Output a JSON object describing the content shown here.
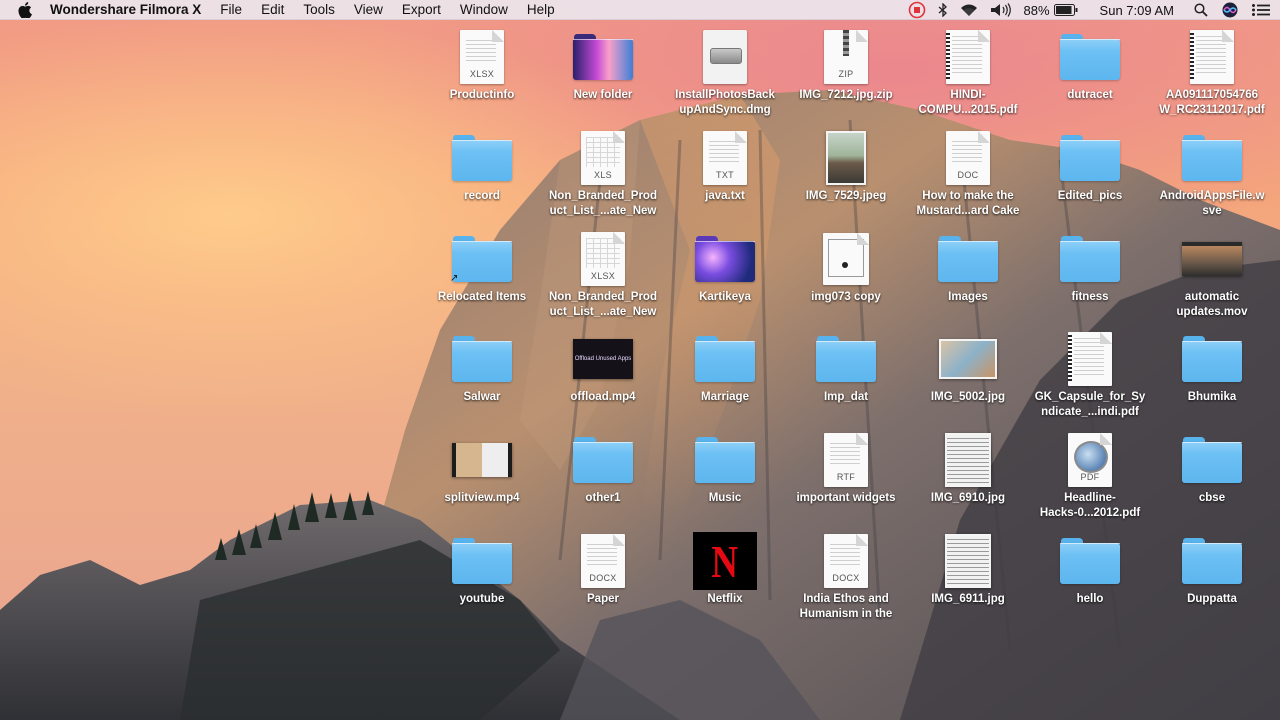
{
  "menubar": {
    "app_name": "Wondershare Filmora X",
    "menus": [
      "File",
      "Edit",
      "Tools",
      "View",
      "Export",
      "Window",
      "Help"
    ],
    "status": {
      "record_icon": "record-stop-icon",
      "bluetooth_icon": "bluetooth-icon",
      "wifi_icon": "wifi-icon",
      "volume_icon": "volume-icon",
      "battery_percent": "88%",
      "clock": "Sun 7:09 AM",
      "search_icon": "spotlight-icon",
      "siri_icon": "siri-icon",
      "notifications_icon": "notification-center-icon"
    }
  },
  "desktop": {
    "items": [
      {
        "label": "Productinfo",
        "kind": "doc",
        "ext": "XLSX"
      },
      {
        "label": "New folder",
        "kind": "folder-custom"
      },
      {
        "label": "InstallPhotosBack\nupAndSync.dmg",
        "kind": "dmg"
      },
      {
        "label": "IMG_7212.jpg.zip",
        "kind": "zip",
        "ext": "ZIP"
      },
      {
        "label": "HINDI-\nCOMPU...2015.pdf",
        "kind": "doc-spiral"
      },
      {
        "label": "dutracet",
        "kind": "folder"
      },
      {
        "label": "AA091117054766\nW_RC23112017.pdf",
        "kind": "doc-spiral"
      },
      {
        "label": "record",
        "kind": "folder"
      },
      {
        "label": "Non_Branded_Prod\nuct_List_...ate_New",
        "kind": "doc-grid",
        "ext": "XLS"
      },
      {
        "label": "java.txt",
        "kind": "doc",
        "ext": "TXT"
      },
      {
        "label": "IMG_7529.jpeg",
        "kind": "photo-person"
      },
      {
        "label": "How to make the\nMustard...ard Cake",
        "kind": "doc",
        "ext": "DOC"
      },
      {
        "label": "Edited_pics",
        "kind": "folder"
      },
      {
        "label": "AndroidAppsFile.w\nsve",
        "kind": "folder"
      },
      {
        "label": "Relocated Items",
        "kind": "folder-alias"
      },
      {
        "label": "Non_Branded_Prod\nuct_List_...ate_New",
        "kind": "doc-grid",
        "ext": "XLSX"
      },
      {
        "label": "Kartikeya",
        "kind": "folder-space"
      },
      {
        "label": "img073 copy",
        "kind": "certificate"
      },
      {
        "label": "Images",
        "kind": "folder"
      },
      {
        "label": "fitness",
        "kind": "folder"
      },
      {
        "label": "automatic\nupdates.mov",
        "kind": "video-desktop"
      },
      {
        "label": "Salwar",
        "kind": "folder"
      },
      {
        "label": "offload.mp4",
        "kind": "video-offload",
        "overlay": "Offload Unused Apps"
      },
      {
        "label": "Marriage",
        "kind": "folder"
      },
      {
        "label": "Imp_dat",
        "kind": "folder"
      },
      {
        "label": "IMG_5002.jpg",
        "kind": "photo-card"
      },
      {
        "label": "GK_Capsule_for_Sy\nndicate_...indi.pdf",
        "kind": "doc-spiral"
      },
      {
        "label": "Bhumika",
        "kind": "folder"
      },
      {
        "label": "splitview.mp4",
        "kind": "video-split"
      },
      {
        "label": "other1",
        "kind": "folder"
      },
      {
        "label": "Music",
        "kind": "folder"
      },
      {
        "label": "important widgets",
        "kind": "doc",
        "ext": "RTF"
      },
      {
        "label": "IMG_6910.jpg",
        "kind": "photo-form"
      },
      {
        "label": "Headline-\nHacks-0...2012.pdf",
        "kind": "doc-pdf",
        "ext": "PDF"
      },
      {
        "label": "cbse",
        "kind": "folder"
      },
      {
        "label": "youtube",
        "kind": "folder"
      },
      {
        "label": "Paper",
        "kind": "doc",
        "ext": "DOCX"
      },
      {
        "label": "Netflix",
        "kind": "netflix",
        "logo": "N"
      },
      {
        "label": "India Ethos and\nHumanism in the",
        "kind": "doc",
        "ext": "DOCX"
      },
      {
        "label": "IMG_6911.jpg",
        "kind": "photo-form"
      },
      {
        "label": "hello",
        "kind": "folder"
      },
      {
        "label": "Duppatta",
        "kind": "folder"
      }
    ]
  },
  "colors": {
    "folder_blue": "#6cc0f4",
    "menubar_bg": "#ece5ec",
    "record_red": "#e0333b",
    "netflix_red": "#e50914"
  }
}
